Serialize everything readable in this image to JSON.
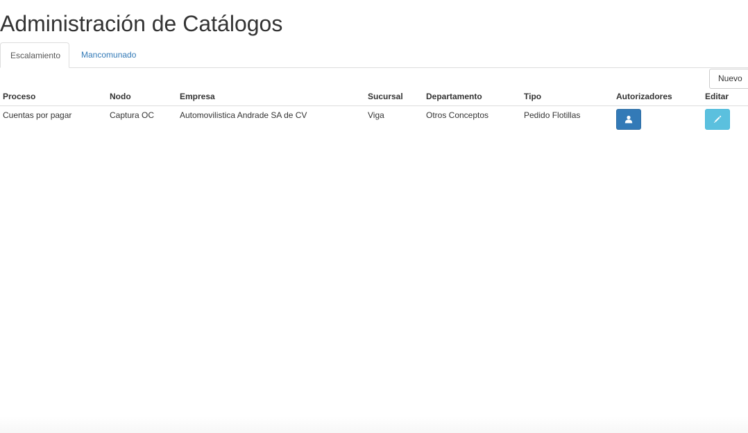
{
  "page": {
    "title": "Administración de Catálogos"
  },
  "tabs": [
    {
      "label": "Escalamiento",
      "active": true
    },
    {
      "label": "Mancomunado",
      "active": false
    }
  ],
  "toolbar": {
    "new_label": "Nuevo"
  },
  "table": {
    "columns": [
      "Proceso",
      "Nodo",
      "Empresa",
      "Sucursal",
      "Departamento",
      "Tipo",
      "Autorizadores",
      "Editar"
    ],
    "rows": [
      {
        "proceso": "Cuentas por pagar",
        "nodo": "Captura OC",
        "empresa": "Automovilistica Andrade SA de CV",
        "sucursal": "Viga",
        "departamento": "Otros Conceptos",
        "tipo": "Pedido Flotillas",
        "autorizadores_icon": "user-icon",
        "editar_icon": "pencil-icon"
      }
    ]
  },
  "colors": {
    "primary": "#337ab7",
    "info": "#5bc0de",
    "link": "#337ab7"
  }
}
